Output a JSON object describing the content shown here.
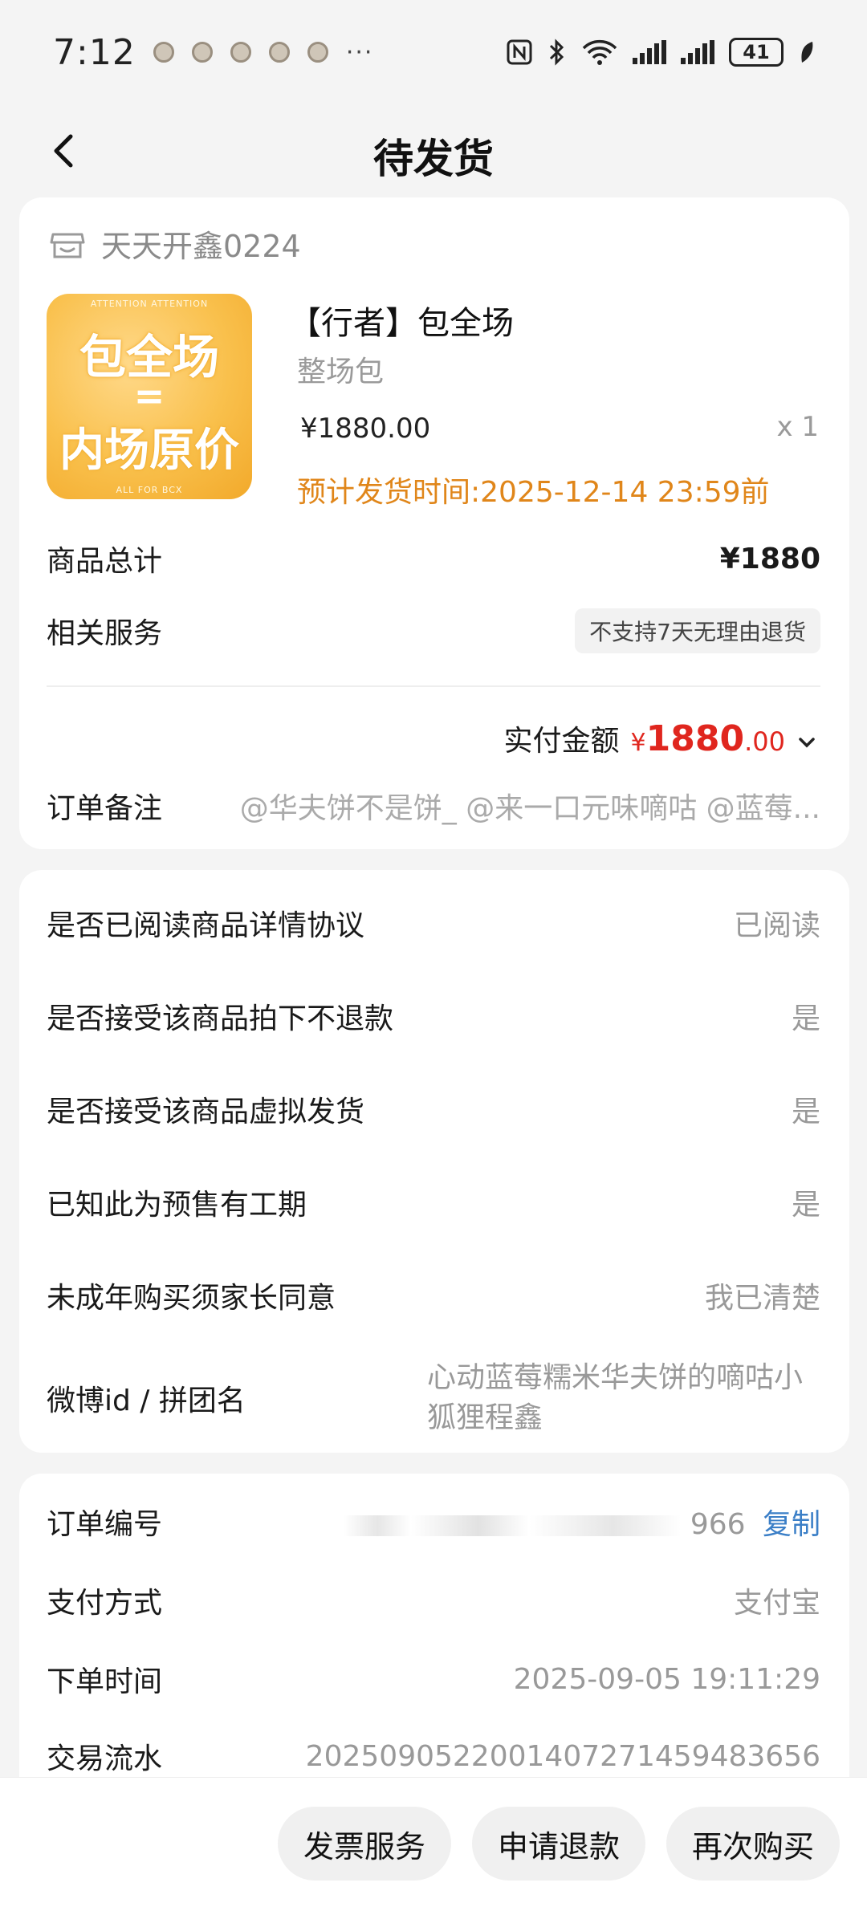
{
  "status_bar": {
    "time": "7:12",
    "more": "···",
    "battery": "41",
    "icons": [
      "notification-icon",
      "nfc-icon",
      "bluetooth-icon",
      "wifi-icon",
      "signal-icon",
      "signal-icon",
      "battery-icon",
      "leaf-icon"
    ]
  },
  "header": {
    "title": "待发货",
    "back_icon": "chevron-left-icon"
  },
  "shop": {
    "name": "天天开鑫0224",
    "icon": "shop-icon"
  },
  "product": {
    "image_line1": "包全场",
    "image_line2": "=",
    "image_line3": "内场原价",
    "image_small_top": "ATTENTION     ATTENTION",
    "image_small_bottom": "ALL FOR BCX",
    "title": "【行者】包全场",
    "subtitle": "整场包",
    "price": "¥1880.00",
    "qty": "x 1",
    "eta": "预计发货时间:2025-12-14 23:59前"
  },
  "summary": {
    "total_label": "商品总计",
    "total_value": "¥1880",
    "service_label": "相关服务",
    "service_tag": "不支持7天无理由退货",
    "paid_label": "实付金额",
    "paid_currency": "¥",
    "paid_integer": "1880",
    "paid_decimal": ".00",
    "note_label": "订单备注",
    "note_value": "@华夫饼不是饼_ @来一口元味嘀咕 @蓝莓..."
  },
  "agreements": [
    {
      "label": "是否已阅读商品详情协议",
      "value": "已阅读"
    },
    {
      "label": "是否接受该商品拍下不退款",
      "value": "是"
    },
    {
      "label": "是否接受该商品虚拟发货",
      "value": "是"
    },
    {
      "label": "已知此为预售有工期",
      "value": "是"
    },
    {
      "label": "未成年购买须家长同意",
      "value": "我已清楚"
    },
    {
      "label": "微博id / 拼团名",
      "value": "心动蓝莓糯米华夫饼的嘀咕小狐狸程鑫"
    }
  ],
  "order_info": {
    "order_no_label": "订单编号",
    "order_no_suffix": "966",
    "copy_label": "复制",
    "payment_label": "支付方式",
    "payment_value": "支付宝",
    "time_label": "下单时间",
    "time_value": "2025-09-05 19:11:29",
    "txn_label": "交易流水",
    "txn_value": "2025090522001407271459483656"
  },
  "actions": {
    "invoice": "发票服务",
    "refund": "申请退款",
    "rebuy": "再次购买"
  }
}
